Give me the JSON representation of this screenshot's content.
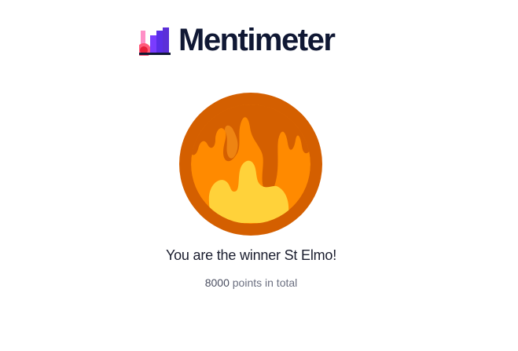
{
  "brand": {
    "name": "Mentimeter",
    "logo_icon": "mentimeter-logo-icon"
  },
  "result": {
    "avatar_icon": "fire-icon",
    "winner_text": "You are the winner St Elmo!",
    "points_value": "8000",
    "points_suffix": " points in total"
  },
  "colors": {
    "fire_outer": "#d45f00",
    "fire_mid": "#ff8a00",
    "fire_inner": "#ffd23a",
    "text_dark": "#1a1d2e",
    "text_muted": "#6b6f80"
  }
}
